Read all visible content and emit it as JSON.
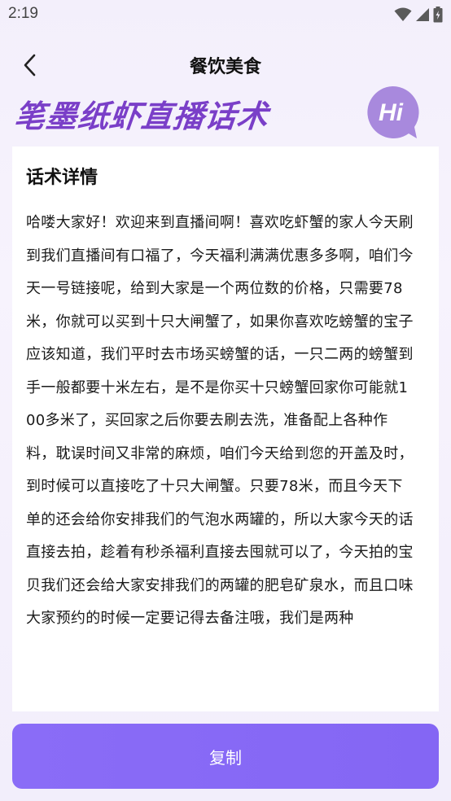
{
  "status_bar": {
    "time": "2:19",
    "icons": [
      "wifi-icon",
      "signal-icon",
      "battery-icon"
    ]
  },
  "nav": {
    "back_icon": "chevron-left-icon",
    "title": "餐饮美食"
  },
  "banner": {
    "title": "笔墨纸虾直播话术",
    "badge_text": "Hi"
  },
  "card": {
    "title": "话术详情",
    "body": "哈喽大家好！欢迎来到直播间啊！喜欢吃虾蟹的家人今天刷到我们直播间有口福了，今天福利满满优惠多多啊，咱们今天一号链接呢，给到大家是一个两位数的价格，只需要78米，你就可以买到十只大闸蟹了，如果你喜欢吃螃蟹的宝子应该知道，我们平时去市场买螃蟹的话，一只二两的螃蟹到手一般都要十米左右，是不是你买十只螃蟹回家你可能就100多米了，买回家之后你要去刷去洗，准备配上各种作料，耽误时间又非常的麻烦，咱们今天给到您的开盖及时，到时候可以直接吃了十只大闸蟹。只要78米，而且今天下单的还会给你安排我们的气泡水两罐的，所以大家今天的话直接去拍，趁着有秒杀福利直接去囤就可以了，今天拍的宝贝我们还会给大家安排我们的两罐的肥皂矿泉水，而且口味大家预约的时候一定要记得去备注哦，我们是两种"
  },
  "actions": {
    "copy_label": "复制"
  },
  "colors": {
    "accent": "#8a6cf7",
    "title_purple": "#7a3fc8",
    "badge_purple": "#a889dd"
  }
}
